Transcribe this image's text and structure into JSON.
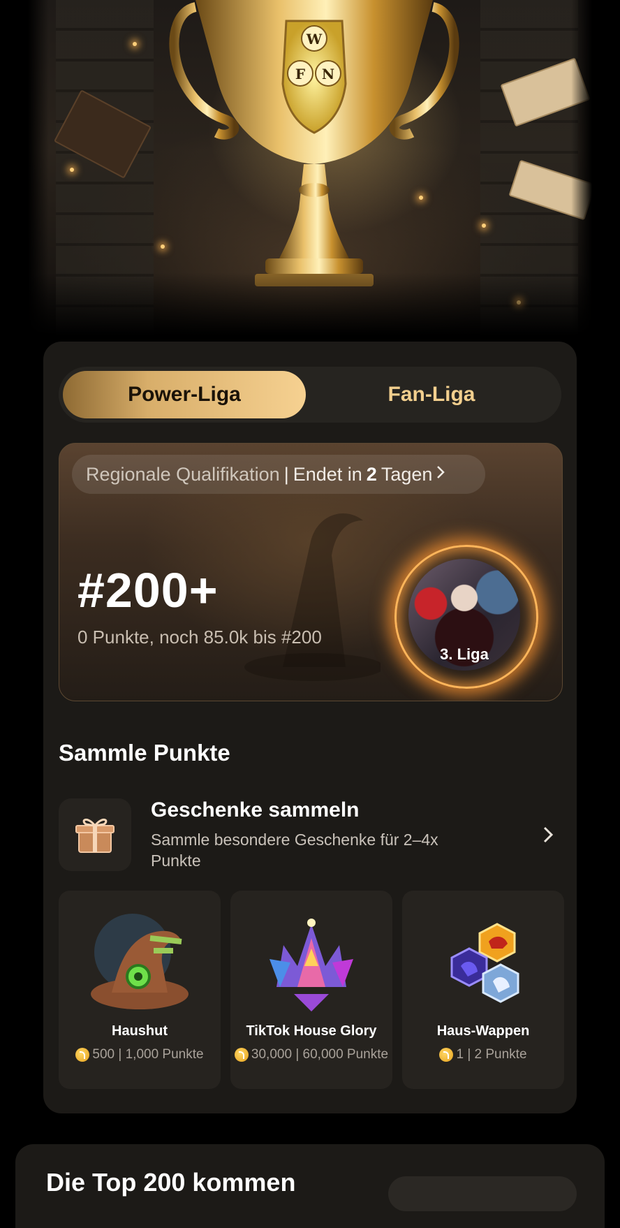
{
  "hero": {
    "image": "trophy-library-banner",
    "crest_letters": [
      "W",
      "F",
      "N"
    ]
  },
  "tabs": [
    {
      "label": "Power-Liga",
      "active": true
    },
    {
      "label": "Fan-Liga",
      "active": false
    }
  ],
  "rank_card": {
    "qualification_label": "Regionale Qualifikation",
    "separator": "|",
    "ends_prefix": "Endet in",
    "ends_days": "2",
    "ends_suffix": "Tagen",
    "rank": "#200+",
    "points_text": "0 Punkte, noch 85.0k bis #200",
    "league_label": "3. Liga"
  },
  "collect": {
    "section_title": "Sammle Punkte",
    "gift_title": "Geschenke sammeln",
    "gift_desc": "Sammle besondere Geschenke für 2–4x Punkte",
    "items": [
      {
        "name": "Haushut",
        "points": "500 | 1,000 Punkte",
        "icon": "wizard-hat-icon"
      },
      {
        "name": "TikTok House Glory",
        "points": "30,000 | 60,000 Punkte",
        "icon": "crystal-crown-icon"
      },
      {
        "name": "Haus-Wappen",
        "points": "1 | 2 Punkte",
        "icon": "house-crests-icon"
      }
    ]
  },
  "bottom": {
    "title": "Die Top 200 kommen"
  },
  "colors": {
    "accent_gold": "#f2cf8e",
    "panel_bg": "#1c1a17",
    "card_bg": "#26231f"
  }
}
